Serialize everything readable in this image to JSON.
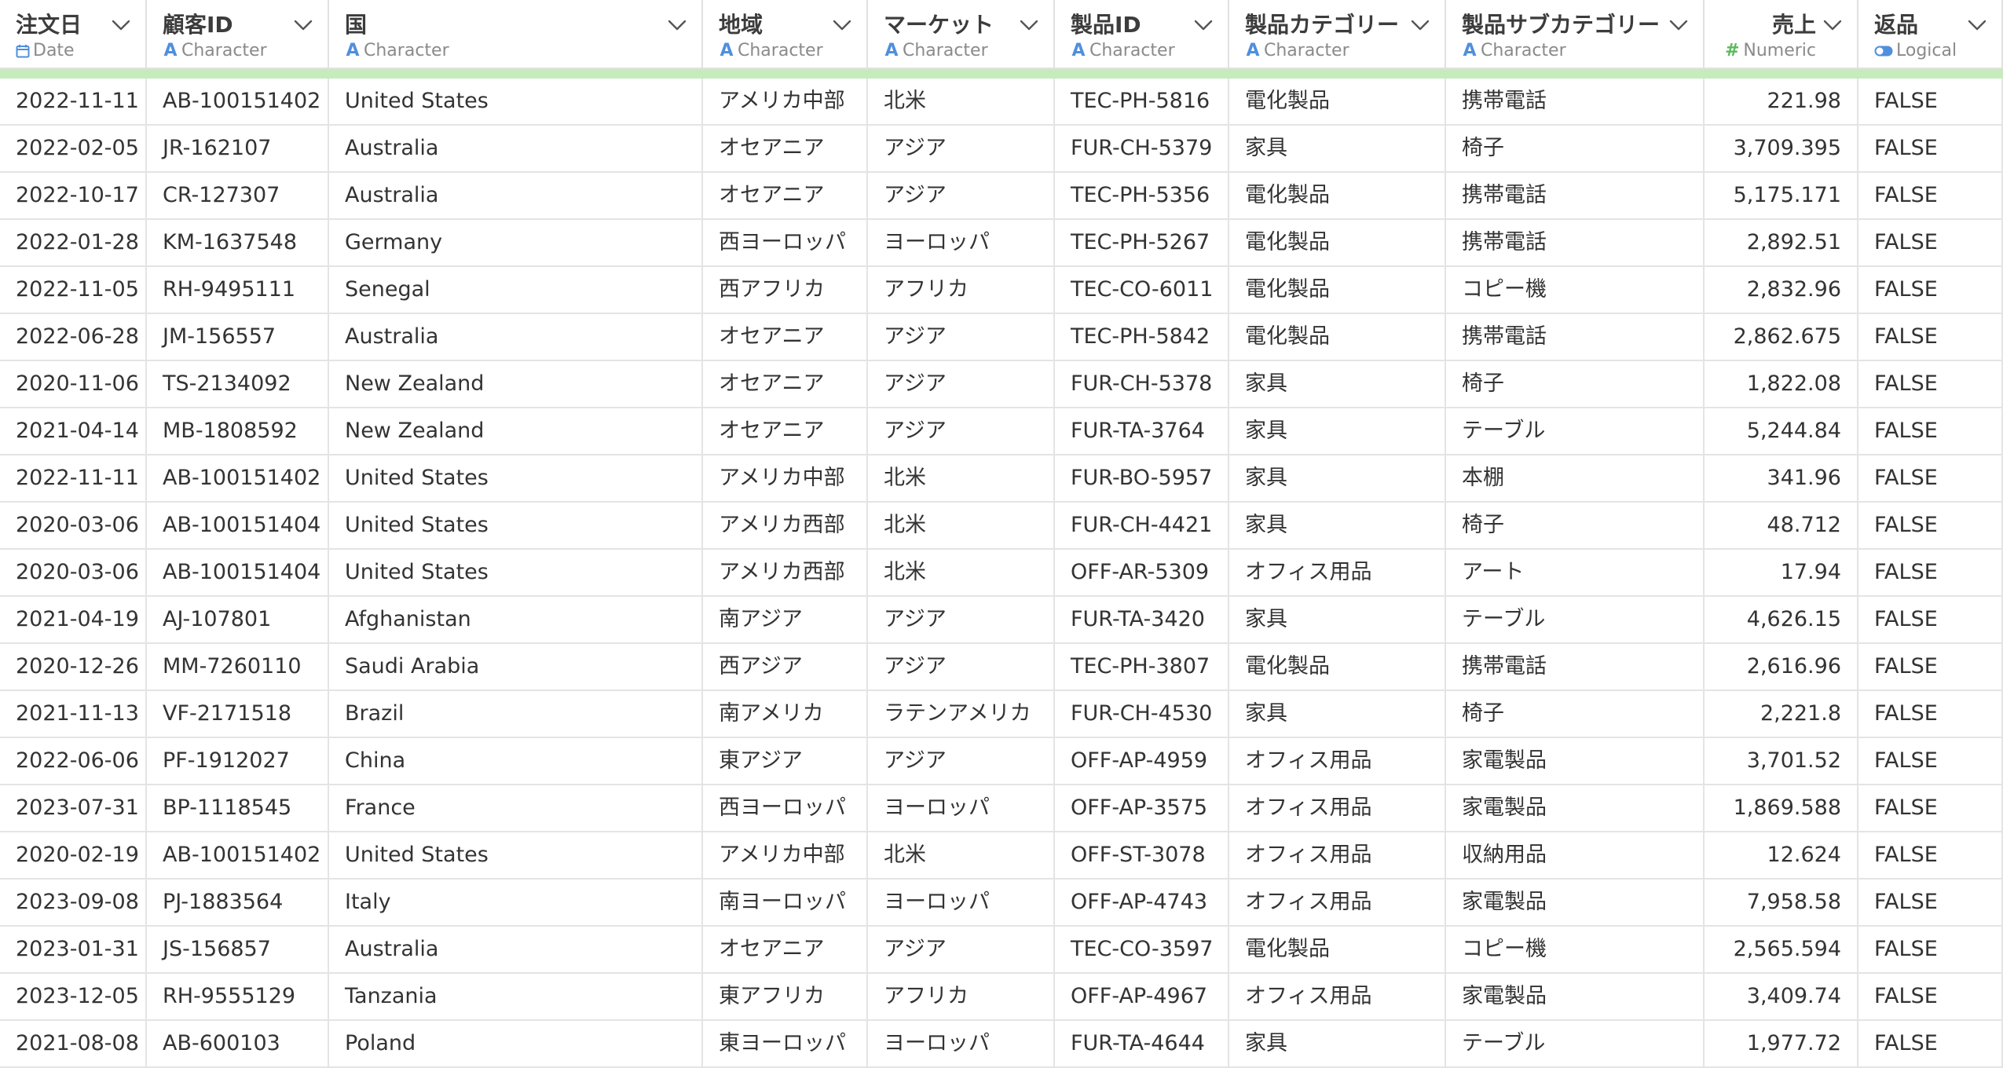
{
  "columns": [
    {
      "name": "注文日",
      "type": "Date",
      "icon": "calendar-icon",
      "align": "left"
    },
    {
      "name": "顧客ID",
      "type": "Character",
      "icon": "character-type-icon",
      "align": "left"
    },
    {
      "name": "国",
      "type": "Character",
      "icon": "character-type-icon",
      "align": "left"
    },
    {
      "name": "地域",
      "type": "Character",
      "icon": "character-type-icon",
      "align": "left"
    },
    {
      "name": "マーケット",
      "type": "Character",
      "icon": "character-type-icon",
      "align": "left"
    },
    {
      "name": "製品ID",
      "type": "Character",
      "icon": "character-type-icon",
      "align": "left"
    },
    {
      "name": "製品カテゴリー",
      "type": "Character",
      "icon": "character-type-icon",
      "align": "left"
    },
    {
      "name": "製品サブカテゴリー",
      "type": "Character",
      "icon": "character-type-icon",
      "align": "left"
    },
    {
      "name": "売上",
      "type": "Numeric",
      "icon": "numeric-type-icon",
      "align": "right"
    },
    {
      "name": "返品",
      "type": "Logical",
      "icon": "logical-toggle-icon",
      "align": "left"
    }
  ],
  "icon_glyphs": {
    "character": "A",
    "numeric": "#"
  },
  "colors": {
    "accent_blue": "#4f8fdd",
    "numeric_green": "#5cb85c",
    "status_bar": "#c6ecbd"
  },
  "rows": [
    [
      "2022-11-11",
      "AB-100151402",
      "United States",
      "アメリカ中部",
      "北米",
      "TEC-PH-5816",
      "電化製品",
      "携帯電話",
      "221.98",
      "FALSE"
    ],
    [
      "2022-02-05",
      "JR-162107",
      "Australia",
      "オセアニア",
      "アジア",
      "FUR-CH-5379",
      "家具",
      "椅子",
      "3,709.395",
      "FALSE"
    ],
    [
      "2022-10-17",
      "CR-127307",
      "Australia",
      "オセアニア",
      "アジア",
      "TEC-PH-5356",
      "電化製品",
      "携帯電話",
      "5,175.171",
      "FALSE"
    ],
    [
      "2022-01-28",
      "KM-1637548",
      "Germany",
      "西ヨーロッパ",
      "ヨーロッパ",
      "TEC-PH-5267",
      "電化製品",
      "携帯電話",
      "2,892.51",
      "FALSE"
    ],
    [
      "2022-11-05",
      "RH-9495111",
      "Senegal",
      "西アフリカ",
      "アフリカ",
      "TEC-CO-6011",
      "電化製品",
      "コピー機",
      "2,832.96",
      "FALSE"
    ],
    [
      "2022-06-28",
      "JM-156557",
      "Australia",
      "オセアニア",
      "アジア",
      "TEC-PH-5842",
      "電化製品",
      "携帯電話",
      "2,862.675",
      "FALSE"
    ],
    [
      "2020-11-06",
      "TS-2134092",
      "New Zealand",
      "オセアニア",
      "アジア",
      "FUR-CH-5378",
      "家具",
      "椅子",
      "1,822.08",
      "FALSE"
    ],
    [
      "2021-04-14",
      "MB-1808592",
      "New Zealand",
      "オセアニア",
      "アジア",
      "FUR-TA-3764",
      "家具",
      "テーブル",
      "5,244.84",
      "FALSE"
    ],
    [
      "2022-11-11",
      "AB-100151402",
      "United States",
      "アメリカ中部",
      "北米",
      "FUR-BO-5957",
      "家具",
      "本棚",
      "341.96",
      "FALSE"
    ],
    [
      "2020-03-06",
      "AB-100151404",
      "United States",
      "アメリカ西部",
      "北米",
      "FUR-CH-4421",
      "家具",
      "椅子",
      "48.712",
      "FALSE"
    ],
    [
      "2020-03-06",
      "AB-100151404",
      "United States",
      "アメリカ西部",
      "北米",
      "OFF-AR-5309",
      "オフィス用品",
      "アート",
      "17.94",
      "FALSE"
    ],
    [
      "2021-04-19",
      "AJ-107801",
      "Afghanistan",
      "南アジア",
      "アジア",
      "FUR-TA-3420",
      "家具",
      "テーブル",
      "4,626.15",
      "FALSE"
    ],
    [
      "2020-12-26",
      "MM-7260110",
      "Saudi Arabia",
      "西アジア",
      "アジア",
      "TEC-PH-3807",
      "電化製品",
      "携帯電話",
      "2,616.96",
      "FALSE"
    ],
    [
      "2021-11-13",
      "VF-2171518",
      "Brazil",
      "南アメリカ",
      "ラテンアメリカ",
      "FUR-CH-4530",
      "家具",
      "椅子",
      "2,221.8",
      "FALSE"
    ],
    [
      "2022-06-06",
      "PF-1912027",
      "China",
      "東アジア",
      "アジア",
      "OFF-AP-4959",
      "オフィス用品",
      "家電製品",
      "3,701.52",
      "FALSE"
    ],
    [
      "2023-07-31",
      "BP-1118545",
      "France",
      "西ヨーロッパ",
      "ヨーロッパ",
      "OFF-AP-3575",
      "オフィス用品",
      "家電製品",
      "1,869.588",
      "FALSE"
    ],
    [
      "2020-02-19",
      "AB-100151402",
      "United States",
      "アメリカ中部",
      "北米",
      "OFF-ST-3078",
      "オフィス用品",
      "収納用品",
      "12.624",
      "FALSE"
    ],
    [
      "2023-09-08",
      "PJ-1883564",
      "Italy",
      "南ヨーロッパ",
      "ヨーロッパ",
      "OFF-AP-4743",
      "オフィス用品",
      "家電製品",
      "7,958.58",
      "FALSE"
    ],
    [
      "2023-01-31",
      "JS-156857",
      "Australia",
      "オセアニア",
      "アジア",
      "TEC-CO-3597",
      "電化製品",
      "コピー機",
      "2,565.594",
      "FALSE"
    ],
    [
      "2023-12-05",
      "RH-9555129",
      "Tanzania",
      "東アフリカ",
      "アフリカ",
      "OFF-AP-4967",
      "オフィス用品",
      "家電製品",
      "3,409.74",
      "FALSE"
    ],
    [
      "2021-08-08",
      "AB-600103",
      "Poland",
      "東ヨーロッパ",
      "ヨーロッパ",
      "FUR-TA-4644",
      "家具",
      "テーブル",
      "1,977.72",
      "FALSE"
    ]
  ]
}
